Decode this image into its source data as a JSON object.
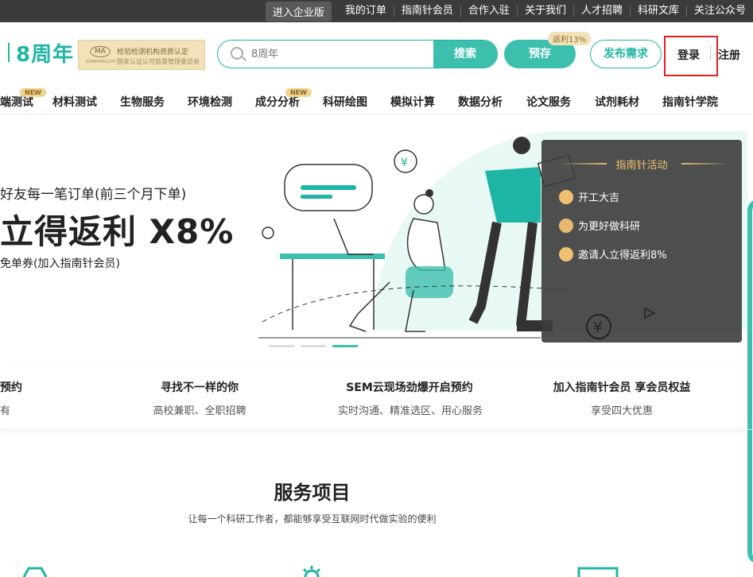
{
  "topbar": {
    "enterprise": "进入企业版",
    "links": [
      "我的订单",
      "指南针会员",
      "合作入驻",
      "关于我们",
      "人才招聘",
      "科研文库",
      "关注公众号"
    ]
  },
  "header": {
    "logo": "8周年",
    "cert": {
      "line1": "检验检测机构资质认定",
      "line2": "国家认证认可监督管理委员会",
      "code": "200804061234",
      "mark": "MA"
    },
    "search_placeholder": "8周年",
    "search_button": "搜索",
    "prestore": "预存",
    "rebate_tag": "返利13%",
    "publish": "发布需求",
    "login": "登录",
    "register": "注册"
  },
  "nav": {
    "items": [
      "端测试",
      "材料测试",
      "生物服务",
      "环境检测",
      "成分分析",
      "科研绘图",
      "模拟计算",
      "数据分析",
      "论文服务",
      "试剂耗材",
      "指南针学院"
    ],
    "badge": "NEW"
  },
  "banner": {
    "line1": "好友每一笔订单(前三个月下单)",
    "line2": "立得返利 X8%",
    "line3": "免单券(加入指南针会员)"
  },
  "activity": {
    "title": "指南针活动",
    "items": [
      "开工大吉",
      "为更好做科研",
      "邀请人立得返利8%"
    ]
  },
  "features": [
    {
      "title": "预约",
      "sub": "有"
    },
    {
      "title": "寻找不一样的你",
      "sub": "高校兼职、全职招聘"
    },
    {
      "title": "SEM云现场劲爆开启预约",
      "sub": "实时沟通、精准选区、用心服务"
    },
    {
      "title": "加入指南针会员 享会员权益",
      "sub": "享受四大优惠"
    }
  ],
  "services": {
    "title": "服务项目",
    "subtitle": "让每一个科研工作者，都能够享受互联网时代做实验的便利"
  },
  "colors": {
    "brand": "#3dbfae",
    "gold": "#f0c070",
    "highlight": "#e02020"
  }
}
